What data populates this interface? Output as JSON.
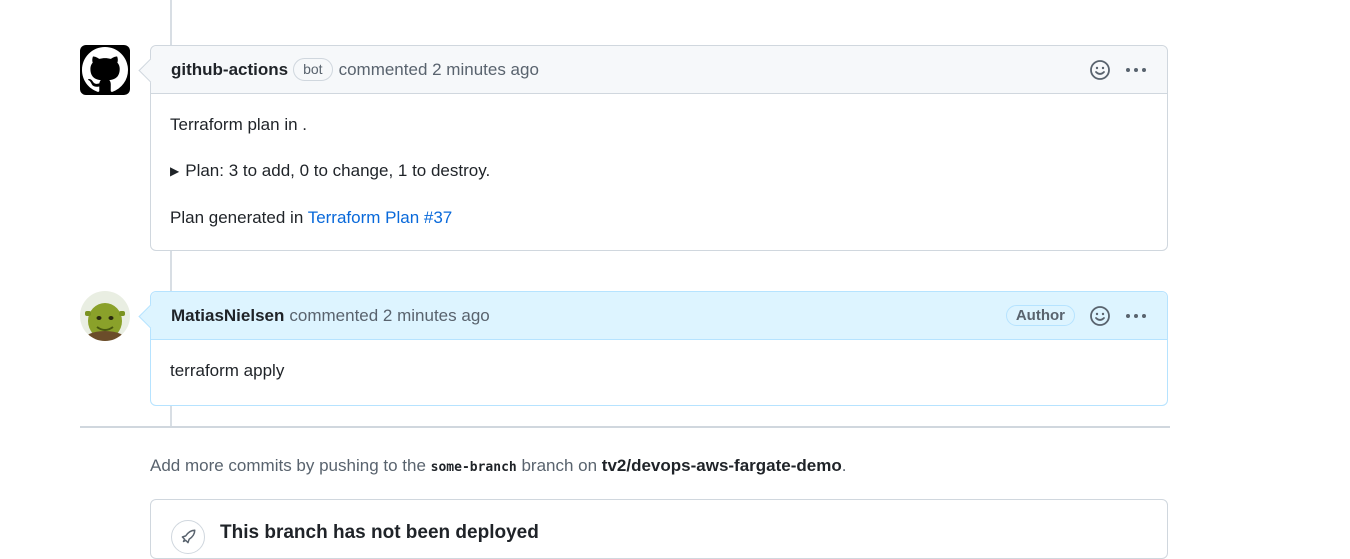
{
  "comments": [
    {
      "username": "github-actions",
      "badge": "bot",
      "meta": "commented 2 minutes ago",
      "avatar_icon": "github-octocat-icon",
      "body": {
        "line1": "Terraform plan in .",
        "summary": "Plan: 3 to add, 0 to change, 1 to destroy.",
        "generated_prefix": "Plan generated in ",
        "generated_link": "Terraform Plan #37"
      }
    },
    {
      "username": "MatiasNielsen",
      "meta": "commented 2 minutes ago",
      "role_badge": "Author",
      "avatar_icon": "user-avatar",
      "body": {
        "text": "terraform apply"
      }
    }
  ],
  "push_hint": {
    "prefix": "Add more commits by pushing to the ",
    "branch": "some-branch",
    "middle": " branch on ",
    "repo": "tv2/devops-aws-fargate-demo",
    "suffix": "."
  },
  "deployment": {
    "title": "This branch has not been deployed",
    "icon": "rocket-icon"
  },
  "colors": {
    "link": "#0969da",
    "author_header": "#ddf4ff",
    "author_border": "#b6e3ff",
    "header_bg": "#f6f8fa"
  }
}
